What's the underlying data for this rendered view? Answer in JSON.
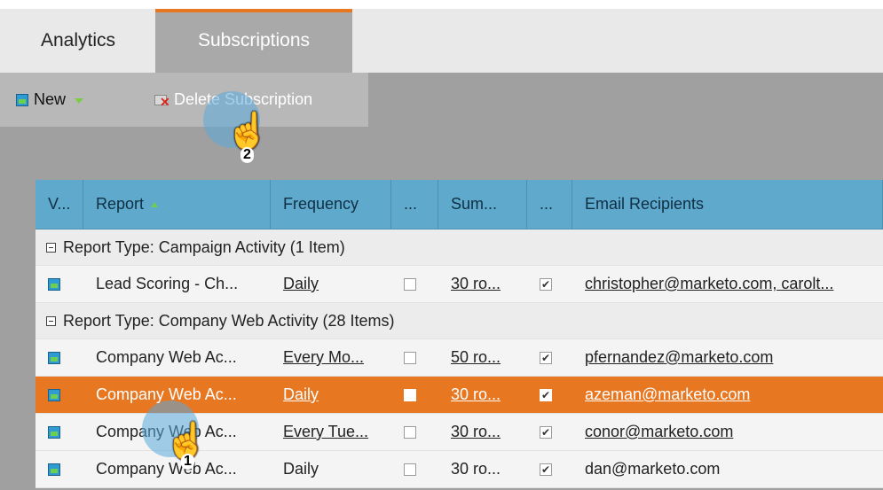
{
  "tabs": [
    {
      "label": "Analytics"
    },
    {
      "label": "Subscriptions"
    }
  ],
  "toolbar": {
    "new_label": "New",
    "delete_label": "Delete Subscription"
  },
  "table": {
    "headers": [
      "V...",
      "Report",
      "Frequency",
      "...",
      "Sum...",
      "...",
      "Email Recipients"
    ],
    "groups": [
      {
        "label": "Report Type: Campaign Activity (1 Item)",
        "rows": [
          {
            "report": "Lead Scoring - Ch...",
            "frequency": "Daily",
            "summary": "30 ro...",
            "checked_a": false,
            "checked_b": true,
            "email": "christopher@marketo.com, carolt..."
          }
        ]
      },
      {
        "label": "Report Type: Company Web Activity (28 Items)",
        "rows": [
          {
            "report": "Company Web Ac...",
            "frequency": "Every Mo...",
            "summary": "50 ro...",
            "checked_a": false,
            "checked_b": true,
            "email": "pfernandez@marketo.com"
          },
          {
            "report": "Company Web Ac...",
            "frequency": "Daily",
            "summary": "30 ro...",
            "checked_a": false,
            "checked_b": true,
            "email": "azeman@marketo.com",
            "selected": true
          },
          {
            "report": "Company Web Ac...",
            "frequency": "Every Tue...",
            "summary": "30 ro...",
            "checked_a": false,
            "checked_b": true,
            "email": "conor@marketo.com"
          },
          {
            "report": "Company Web Ac...",
            "frequency": "Daily",
            "summary": "30 ro...",
            "checked_a": false,
            "checked_b": true,
            "email": "dan@marketo.com"
          }
        ]
      }
    ]
  },
  "callouts": [
    "1",
    "2"
  ],
  "colors": {
    "accent": "#e87722",
    "header": "#5ea9cc"
  }
}
